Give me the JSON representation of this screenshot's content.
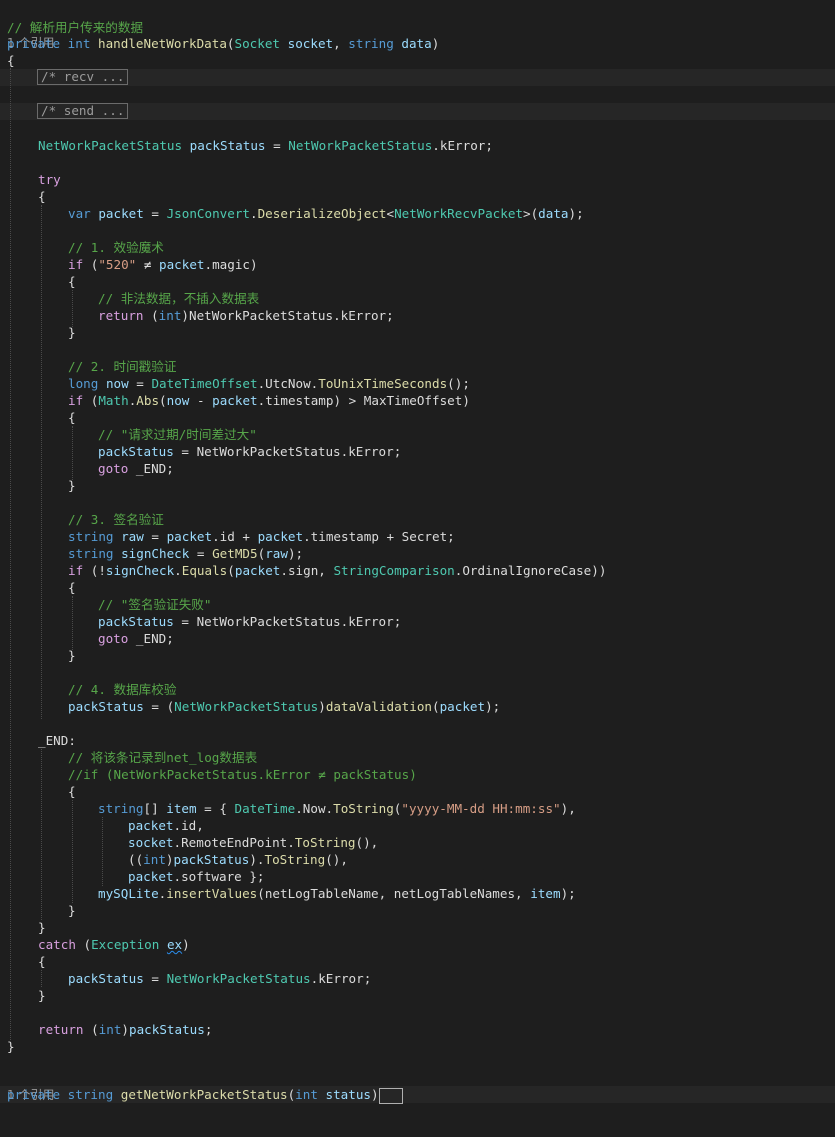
{
  "editor": {
    "comment_header": "// 解析用户传来的数据",
    "ref_count_1": "1 个引用",
    "sig": {
      "kw_private": "private",
      "kw_int": "int",
      "fn_name": "handleNetWorkData",
      "p_open": "(",
      "ty_socket": "Socket",
      "p_socket": "socket",
      "comma": ", ",
      "kw_string": "string",
      "p_data": "data",
      "p_close": ")"
    },
    "brace_open": "{",
    "brace_close": "}",
    "fold_recv": "/* recv ...",
    "fold_send": "/* send ...",
    "l_status_decl": {
      "ty": "NetWorkPacketStatus",
      "var": "packStatus",
      "eq": " = ",
      "ty2": "NetWorkPacketStatus",
      "rest": ".kError;"
    },
    "kw_try": "try",
    "l_var_packet": {
      "kw": "var",
      "var": "packet",
      "eq": " = ",
      "ty": "JsonConvert",
      "dot": ".",
      "fn": "DeserializeObject",
      "lt": "<",
      "ty2": "NetWorkRecvPacket",
      "gt": ">(",
      "arg": "data",
      "end": ");"
    },
    "c_magic": "// 1. 效验魔术",
    "l_if_magic": {
      "kw": "if",
      "open": " (",
      "str": "\"520\"",
      "op": " ≠ ",
      "var": "packet",
      "rest": ".magic)"
    },
    "c_illegal": "// 非法数据，不插入数据表",
    "l_return_err": {
      "kw": "return",
      "open": " (",
      "kw2": "int",
      "rest": ")NetWorkPacketStatus.kError;"
    },
    "c_timestamp": "// 2. 时间戳验证",
    "l_long_now": {
      "kw": "long",
      "var": "now",
      "eq": " = ",
      "ty": "DateTimeOffset",
      "rest1": ".UtcNow.",
      "fn": "ToUnixTimeSeconds",
      "end": "();"
    },
    "l_if_abs": {
      "kw": "if",
      "open": " (",
      "ty": "Math",
      "dot": ".",
      "fn": "Abs",
      "p": "(",
      "v1": "now",
      "minus": " - ",
      "v2": "packet",
      "rest": ".timestamp) > MaxTimeOffset)"
    },
    "c_expired": "// \"请求过期/时间差过大\"",
    "l_status_err": {
      "var": "packStatus",
      "eq": " = ",
      "rest": "NetWorkPacketStatus.kError;"
    },
    "l_goto": {
      "kw": "goto",
      "rest": " _END;"
    },
    "c_sign": "// 3. 签名验证",
    "l_raw": {
      "kw": "string",
      "var": "raw",
      "eq": " = ",
      "v1": "packet",
      "r1": ".id + ",
      "v2": "packet",
      "r2": ".timestamp + Secret;"
    },
    "l_signcheck": {
      "kw": "string",
      "var": "signCheck",
      "eq": " = ",
      "fn": "GetMD5",
      "p": "(",
      "arg": "raw",
      "end": ");"
    },
    "l_if_sign": {
      "kw": "if",
      "open": " (!",
      "var": "signCheck",
      "dot": ".",
      "fn": "Equals",
      "p": "(",
      "v2": "packet",
      "r1": ".sign, ",
      "ty": "StringComparison",
      "r2": ".OrdinalIgnoreCase))"
    },
    "c_sign_fail": "// \"签名验证失败\"",
    "c_db": "// 4. 数据库校验",
    "l_validation": {
      "var": "packStatus",
      "eq": " = (",
      "ty": "NetWorkPacketStatus",
      "close": ")",
      "fn": "dataValidation",
      "p": "(",
      "arg": "packet",
      "end": ");"
    },
    "label_end": "_END:",
    "c_record": "// 将该条记录到net_log数据表",
    "c_if_disabled": "//if (NetWorkPacketStatus.kError ≠ packStatus)",
    "l_item": {
      "kw": "string",
      "br": "[] ",
      "var": "item",
      "eq": " = { ",
      "ty": "DateTime",
      "dot": ".",
      "r1": "Now.",
      "fn": "ToString",
      "p": "(",
      "str": "\"yyyy-MM-dd HH:mm:ss\"",
      "end": "),"
    },
    "l_item_id": {
      "var": "packet",
      "rest": ".id,"
    },
    "l_item_remote": {
      "var": "socket",
      "r1": ".RemoteEndPoint.",
      "fn": "ToString",
      "end": "(),"
    },
    "l_item_status": {
      "open": "((",
      "kw": "int",
      "close": ")",
      "var": "packStatus",
      "r1": ").",
      "fn": "ToString",
      "end": "(),"
    },
    "l_item_software": {
      "var": "packet",
      "rest": ".software };"
    },
    "l_insert": {
      "var": "mySQLite",
      "dot": ".",
      "fn": "insertValues",
      "rest": "(netLogTableName, netLogTableNames, ",
      "arg": "item",
      "end": ");"
    },
    "l_catch": {
      "kw": "catch",
      "open": " (",
      "ty": "Exception",
      "sp": " ",
      "var": "ex",
      "close": ")"
    },
    "l_catch_status": {
      "var": "packStatus",
      "eq": " = ",
      "ty": "NetWorkPacketStatus",
      "rest": ".kError;"
    },
    "l_final_return": {
      "kw": "return",
      "open": " (",
      "kw2": "int",
      "close": ")",
      "var": "packStatus",
      "end": ";"
    },
    "ref_count_2": "1 个引用",
    "l_next_sig": {
      "kw": "private",
      "kw2": "string",
      "fn": "getNetWorkPacketStatus",
      "open": "(",
      "kw3": "int",
      "var": "status",
      "close": ")"
    }
  },
  "colors": {
    "background": "#1e1e1e",
    "keyword": "#569cd6",
    "control": "#d8a0df",
    "type": "#4ec9b0",
    "method": "#dcdcaa",
    "variable": "#9cdcfe",
    "comment": "#57a64a",
    "string": "#d69d85"
  }
}
